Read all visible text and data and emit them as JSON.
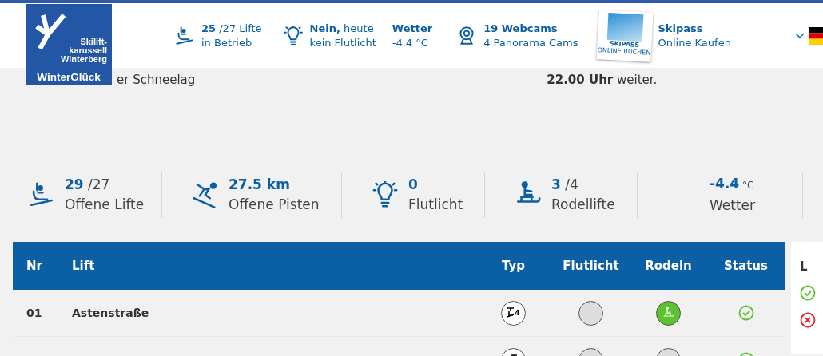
{
  "logo": {
    "lines": [
      "Skilift-",
      "karussell",
      "Winterberg"
    ],
    "tagline": "WinterGlück"
  },
  "header_items": [
    {
      "kind": "lift",
      "value": "25",
      "rest": " /27 Lifte",
      "sub": "in Betrieb"
    },
    {
      "kind": "light",
      "value": "Nein,",
      "rest": " heute",
      "sub": "kein Flutlicht"
    },
    {
      "kind": "weather",
      "value": "Wetter",
      "sub": "-4.4 °C"
    },
    {
      "kind": "webcam",
      "value": "19 Webcams",
      "sub": "4 Panorama Cams"
    },
    {
      "kind": "skipass",
      "value": "Skipass",
      "sub": "Online Kaufen",
      "card_title": "SKIPASS",
      "card_sub": "ONLINE BUCHEN"
    }
  ],
  "intro": {
    "left": "er Schneelag",
    "right": "**22.00 Uhr** weiter."
  },
  "stats": [
    {
      "kind": "lift",
      "value": "29",
      "unit": " /27",
      "label": "Offene Lifte"
    },
    {
      "kind": "skier",
      "value": "27.5 km",
      "label": "Offene Pisten"
    },
    {
      "kind": "light",
      "value": "0",
      "label": "Flutlicht"
    },
    {
      "kind": "sled",
      "value": "3",
      "unit": " /4",
      "label": "Rodellifte"
    },
    {
      "kind": "weather",
      "value": "-4.4",
      "unit": " °C",
      "label": "Wetter"
    }
  ],
  "table": {
    "columns": [
      "Nr",
      "Lift",
      "Typ",
      "Flutlicht",
      "Rodeln",
      "Status"
    ],
    "rows": [
      {
        "nr": "01",
        "lift": "Astenstraße",
        "typ": "4",
        "flutlicht": false,
        "rodeln": true,
        "open": true
      },
      {
        "flutlicht": false,
        "rodeln": false,
        "open": true
      }
    ]
  },
  "legend": {
    "title": "L",
    "items": [
      {
        "kind": "open"
      },
      {
        "kind": "closed"
      }
    ]
  }
}
